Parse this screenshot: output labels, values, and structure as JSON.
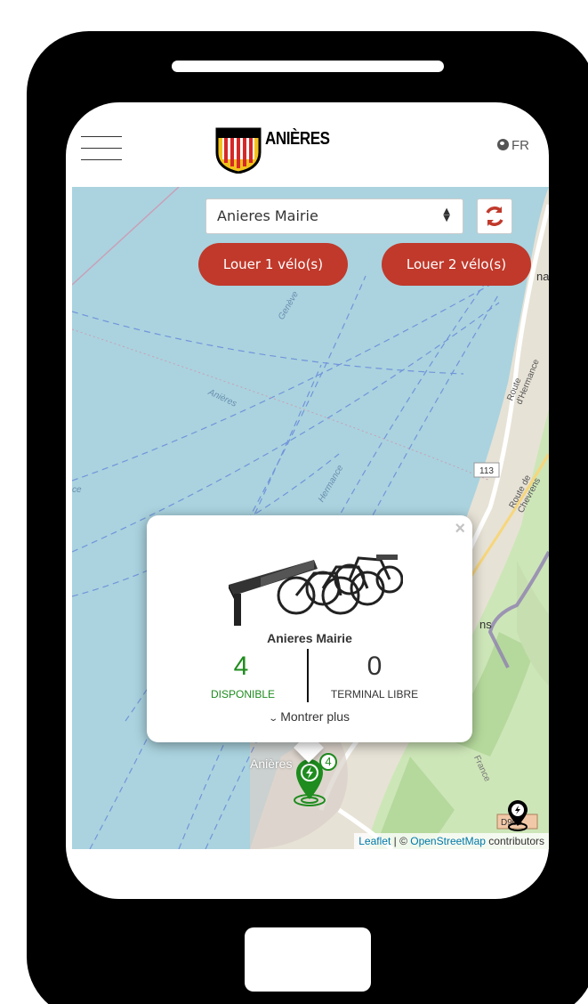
{
  "header": {
    "logo_text": "ANIÈRES",
    "language": "FR",
    "menu_icon": "hamburger-icon",
    "globe_icon": "globe-icon"
  },
  "controls": {
    "station_select": "Anieres Mairie",
    "rent_1_label": "Louer 1 vélo(s)",
    "rent_2_label": "Louer 2 vélo(s)",
    "refresh_icon": "refresh-icon"
  },
  "popup": {
    "station_name": "Anieres Mairie",
    "available_count": "4",
    "available_label": "DISPONIBLE",
    "free_terminals_count": "0",
    "free_terminals_label": "TERMINAL LIBRE",
    "show_more_label": "Montrer plus",
    "close_label": "×"
  },
  "map": {
    "labels": {
      "anieres_lake": "Anières",
      "hermance": "Hermance",
      "geneve": "Genève",
      "route_hermance": "Route d'Hermance",
      "route_chevrens": "Route de Chevrens",
      "road_113": "113",
      "anieres_town": "Anières",
      "france": "France",
      "d905": "D905",
      "ce": "ce",
      "na": "na",
      "ns": "ns"
    },
    "marker_count": "4",
    "attribution_leaflet": "Leaflet",
    "attribution_sep": " | © ",
    "attribution_osm": "OpenStreetMap",
    "attribution_rest": " contributors"
  },
  "colors": {
    "accent_red": "#c0392b",
    "available_green": "#1e8c1e",
    "water": "#aad3df"
  }
}
